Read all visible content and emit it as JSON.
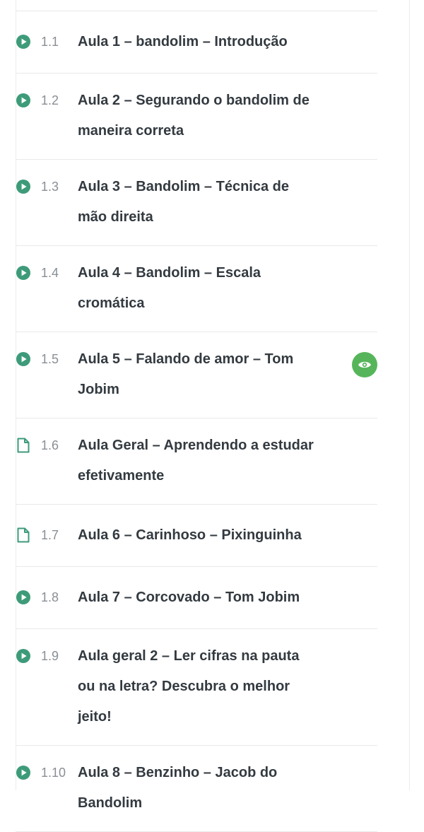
{
  "lessons": [
    {
      "number": "1.1",
      "title": "Aula 1 – bandolim – Introdução",
      "icon": "play-icon"
    },
    {
      "number": "1.2",
      "title": "Aula 2 – Segurando o bandolim de maneira correta",
      "icon": "play-icon"
    },
    {
      "number": "1.3",
      "title": "Aula 3 – Bandolim – Técnica de mão direita",
      "icon": "play-icon"
    },
    {
      "number": "1.4",
      "title": "Aula 4 – Bandolim – Escala cromática",
      "icon": "play-icon"
    },
    {
      "number": "1.5",
      "title": "Aula 5 – Falando de amor – Tom Jobim",
      "icon": "play-icon",
      "preview_icon": "eye-icon"
    },
    {
      "number": "1.6",
      "title": "Aula Geral – Aprendendo a estudar efetivamente",
      "icon": "document-icon"
    },
    {
      "number": "1.7",
      "title": "Aula 6 – Carinhoso – Pixinguinha",
      "icon": "document-icon"
    },
    {
      "number": "1.8",
      "title": "Aula 7 – Corcovado – Tom Jobim",
      "icon": "play-icon"
    },
    {
      "number": "1.9",
      "title": "Aula geral 2 – Ler cifras na pauta ou na letra? Descubra o melhor jeito!",
      "icon": "play-icon"
    },
    {
      "number": "1.10",
      "title": "Aula 8 – Benzinho – Jacob do Bandolim",
      "icon": "play-icon"
    }
  ],
  "colors": {
    "icon_accent": "#3e9b7a",
    "preview_badge": "#56b55a",
    "title_text": "#333a40",
    "number_text": "#8a8f95"
  }
}
